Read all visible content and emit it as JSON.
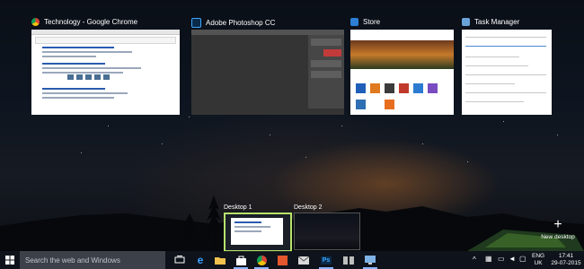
{
  "windows": [
    {
      "title": "Technology - Google Chrome",
      "icon": "chrome-icon"
    },
    {
      "title": "Adobe Photoshop CC",
      "icon": "photoshop-icon"
    },
    {
      "title": "Store",
      "icon": "store-icon"
    },
    {
      "title": "Task Manager",
      "icon": "task-manager-icon"
    }
  ],
  "desktops": [
    {
      "label": "Desktop 1",
      "selected": true
    },
    {
      "label": "Desktop 2",
      "selected": false
    }
  ],
  "new_desktop": {
    "label": "New desktop",
    "icon": "plus-icon"
  },
  "taskbar": {
    "search_placeholder": "Search the web and Windows",
    "icons": [
      "task-view-icon",
      "edge-icon",
      "file-explorer-icon",
      "store-icon",
      "chrome-icon",
      "office-icon",
      "mail-icon",
      "photoshop-icon",
      "reader-icon",
      "monitor-icon"
    ],
    "tray": {
      "language": "ENG",
      "region": "UK",
      "time": "17:41",
      "date": "29-07-2015"
    }
  },
  "colors": {
    "accent": "#8ab4ff",
    "selected_desktop_border": "#b7e36b"
  }
}
